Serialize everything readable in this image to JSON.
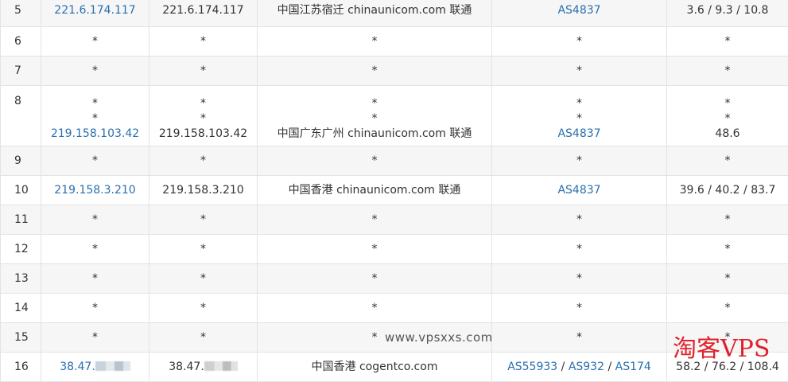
{
  "rows": [
    {
      "hop": "5",
      "ip_link": "221.6.174.117",
      "ip": "221.6.174.117",
      "location": "中国江苏宿迁 chinaunicom.com 联通",
      "asn": "AS4837",
      "rtt": "3.6 / 9.3 / 10.8"
    },
    {
      "hop": "6",
      "ip_link": "*",
      "ip": "*",
      "location": "*",
      "asn": "*",
      "rtt": "*"
    },
    {
      "hop": "7",
      "ip_link": "*",
      "ip": "*",
      "location": "*",
      "asn": "*",
      "rtt": "*"
    },
    {
      "hop": "8",
      "ip_link_lines": [
        "*",
        "*",
        "219.158.103.42"
      ],
      "ip_lines": [
        "*",
        "*",
        "219.158.103.42"
      ],
      "location_lines": [
        "*",
        "*",
        "中国广东广州 chinaunicom.com 联通"
      ],
      "asn_lines": [
        "*",
        "*",
        "AS4837"
      ],
      "rtt_lines": [
        "*",
        "*",
        "48.6"
      ]
    },
    {
      "hop": "9",
      "ip_link": "*",
      "ip": "*",
      "location": "*",
      "asn": "*",
      "rtt": "*"
    },
    {
      "hop": "10",
      "ip_link": "219.158.3.210",
      "ip": "219.158.3.210",
      "location": "中国香港 chinaunicom.com 联通",
      "asn": "AS4837",
      "rtt": "39.6 / 40.2 / 83.7"
    },
    {
      "hop": "11",
      "ip_link": "*",
      "ip": "*",
      "location": "*",
      "asn": "*",
      "rtt": "*"
    },
    {
      "hop": "12",
      "ip_link": "*",
      "ip": "*",
      "location": "*",
      "asn": "*",
      "rtt": "*"
    },
    {
      "hop": "13",
      "ip_link": "*",
      "ip": "*",
      "location": "*",
      "asn": "*",
      "rtt": "*"
    },
    {
      "hop": "14",
      "ip_link": "*",
      "ip": "*",
      "location": "*",
      "asn": "*",
      "rtt": "*"
    },
    {
      "hop": "15",
      "ip_link": "*",
      "ip": "*",
      "location": "*",
      "asn": "*",
      "rtt": "*"
    },
    {
      "hop": "16",
      "ip_link": "38.47.",
      "ip": "38.47.",
      "location": "中国香港 cogentco.com",
      "asn_list": [
        "AS55933",
        "AS932",
        "AS174"
      ],
      "asn_sep": " / ",
      "rtt": "58.2 / 76.2 / 108.4"
    }
  ],
  "watermarks": {
    "url": "www.vpsxxs.com",
    "brand": "淘客VPS"
  },
  "colors": {
    "link": "#2a6fb0",
    "border": "#e3e3e3",
    "row_alt": "#f6f6f6",
    "brand": "#e0212b"
  }
}
